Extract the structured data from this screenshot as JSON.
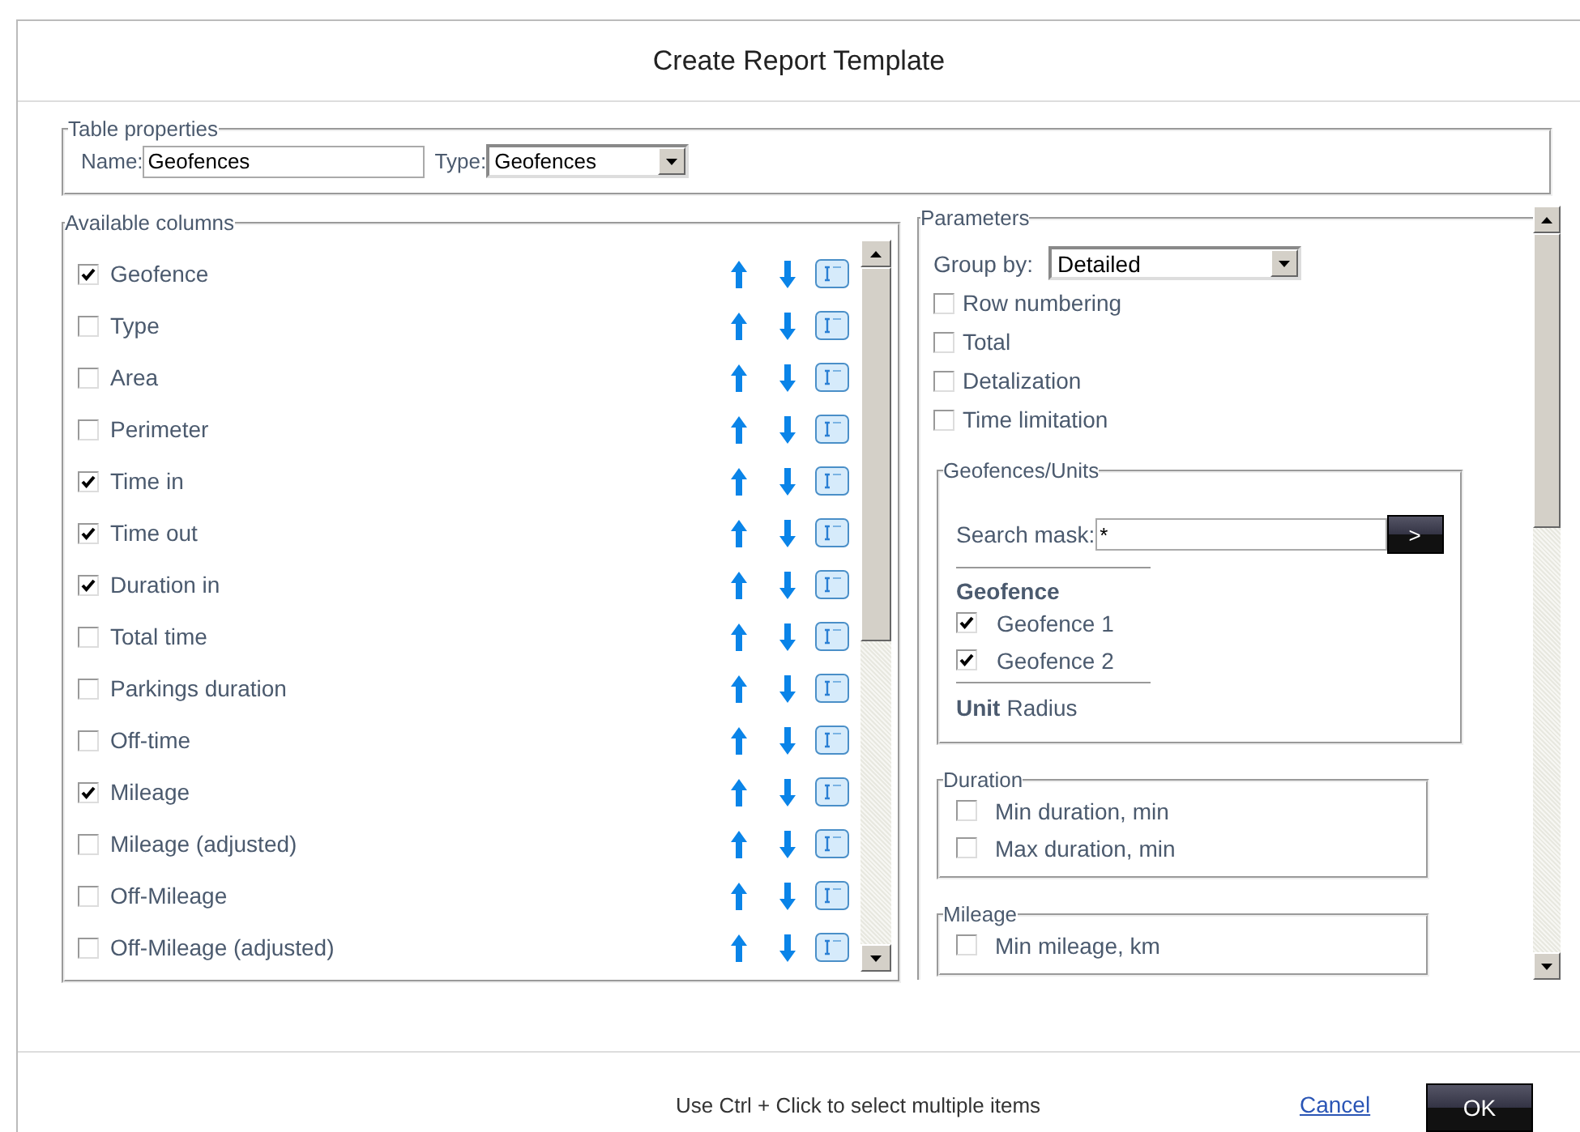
{
  "dialog": {
    "title": "Create Report Template"
  },
  "table_properties": {
    "legend": "Table properties",
    "name_label": "Name:",
    "name_value": "Geofences",
    "type_label": "Type:",
    "type_value": "Geofences"
  },
  "available_columns": {
    "legend": "Available columns",
    "items": [
      {
        "label": "Geofence",
        "checked": true
      },
      {
        "label": "Type",
        "checked": false
      },
      {
        "label": "Area",
        "checked": false
      },
      {
        "label": "Perimeter",
        "checked": false
      },
      {
        "label": "Time in",
        "checked": true
      },
      {
        "label": "Time out",
        "checked": true
      },
      {
        "label": "Duration in",
        "checked": true
      },
      {
        "label": "Total time",
        "checked": false
      },
      {
        "label": "Parkings duration",
        "checked": false
      },
      {
        "label": "Off-time",
        "checked": false
      },
      {
        "label": "Mileage",
        "checked": true
      },
      {
        "label": "Mileage (adjusted)",
        "checked": false
      },
      {
        "label": "Off-Mileage",
        "checked": false
      },
      {
        "label": "Off-Mileage (adjusted)",
        "checked": false
      }
    ]
  },
  "parameters": {
    "legend": "Parameters",
    "group_by_label": "Group by:",
    "group_by_value": "Detailed",
    "options": [
      {
        "label": "Row numbering",
        "checked": false
      },
      {
        "label": "Total",
        "checked": false
      },
      {
        "label": "Detalization",
        "checked": false
      },
      {
        "label": "Time limitation",
        "checked": false
      }
    ],
    "geofences_units": {
      "legend": "Geofences/Units",
      "search_label": "Search mask:",
      "search_value": "*",
      "search_button": ">",
      "geofence_heading": "Geofence",
      "geofences": [
        {
          "label": "Geofence 1",
          "checked": true
        },
        {
          "label": "Geofence 2",
          "checked": true
        }
      ],
      "unit_heading": "Unit",
      "unit_value": "Radius"
    },
    "sections": [
      {
        "legend": "Duration",
        "items": [
          {
            "label": "Min duration, min",
            "checked": false
          },
          {
            "label": "Max duration, min",
            "checked": false
          }
        ]
      },
      {
        "legend": "Mileage",
        "items": [
          {
            "label": "Min mileage, km",
            "checked": false
          }
        ]
      }
    ]
  },
  "footer": {
    "hint": "Use Ctrl + Click to select multiple items",
    "cancel": "Cancel",
    "ok": "OK"
  }
}
